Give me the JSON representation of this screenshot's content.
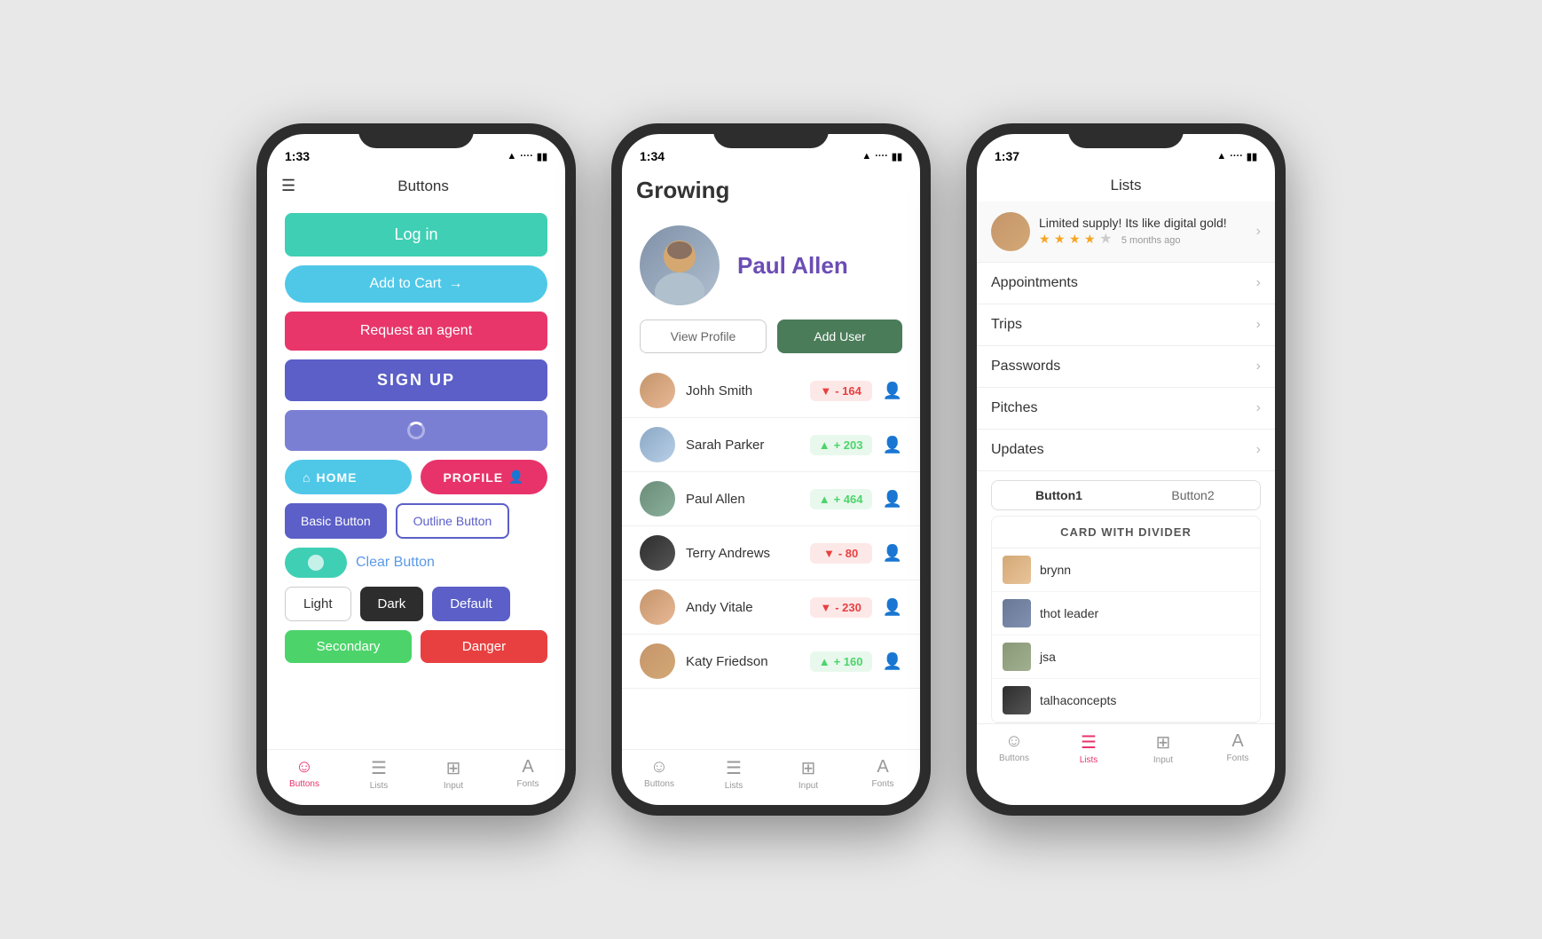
{
  "phone1": {
    "status": {
      "time": "1:33",
      "icons": "▲ .... 🔋"
    },
    "header": {
      "title": "Buttons"
    },
    "buttons": {
      "login": "Log in",
      "addcart": "Add to Cart",
      "agent": "Request an agent",
      "signup": "SIGN UP",
      "home": "HOME",
      "profile": "PROFILE",
      "basic": "Basic Button",
      "outline": "Outline Button",
      "clear": "Clear Button",
      "light": "Light",
      "dark": "Dark",
      "default": "Default",
      "secondary": "Secondary",
      "danger": "Danger"
    },
    "nav": {
      "buttons": "Buttons",
      "lists": "Lists",
      "input": "Input",
      "fonts": "Fonts"
    }
  },
  "phone2": {
    "status": {
      "time": "1:34",
      "icons": "▲ .... 🔋"
    },
    "header": {
      "title": "Growing"
    },
    "profile": {
      "name": "Paul Allen",
      "view_profile": "View Profile",
      "add_user": "Add User"
    },
    "users": [
      {
        "name": "Johh Smith",
        "score": "- 164",
        "type": "red"
      },
      {
        "name": "Sarah Parker",
        "score": "+ 203",
        "type": "green"
      },
      {
        "name": "Paul Allen",
        "score": "+ 464",
        "type": "green"
      },
      {
        "name": "Terry Andrews",
        "score": "- 80",
        "type": "red"
      },
      {
        "name": "Andy Vitale",
        "score": "- 230",
        "type": "red"
      },
      {
        "name": "Katy Friedson",
        "score": "+ 160",
        "type": "green"
      }
    ],
    "nav": {
      "buttons": "Buttons",
      "lists": "Lists",
      "input": "Input",
      "fonts": "Fonts"
    }
  },
  "phone3": {
    "status": {
      "time": "1:37",
      "icons": "▲ .... 🔋"
    },
    "header": {
      "title": "Lists"
    },
    "featured": {
      "quote": "Limited supply! Its like digital gold!",
      "time": "5 months ago",
      "stars": 4
    },
    "list_items": [
      "Appointments",
      "Trips",
      "Passwords",
      "Pitches",
      "Updates"
    ],
    "tabs": [
      "Button1",
      "Button2"
    ],
    "card": {
      "title": "CARD WITH DIVIDER",
      "items": [
        "brynn",
        "thot leader",
        "jsa",
        "talhaconcepts"
      ]
    },
    "nav": {
      "buttons": "Buttons",
      "lists": "Lists",
      "input": "Input",
      "fonts": "Fonts"
    }
  }
}
